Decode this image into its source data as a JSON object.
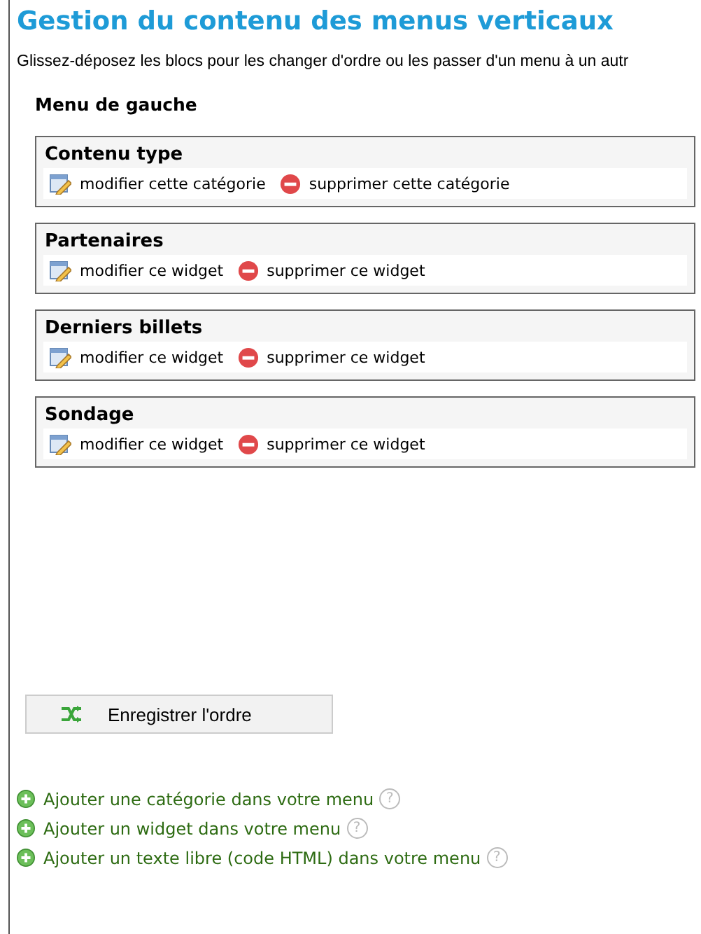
{
  "title": "Gestion du contenu des menus verticaux",
  "intro": "Glissez-déposez les blocs pour les changer d'ordre ou les passer d'un menu à un autr",
  "menu": {
    "heading": "Menu de gauche",
    "blocks": [
      {
        "name": "Contenu type",
        "edit": "modifier cette catégorie",
        "delete": "supprimer cette catégorie"
      },
      {
        "name": "Partenaires",
        "edit": "modifier ce widget",
        "delete": "supprimer ce widget"
      },
      {
        "name": "Derniers billets",
        "edit": "modifier ce widget",
        "delete": "supprimer ce widget"
      },
      {
        "name": "Sondage",
        "edit": "modifier ce widget",
        "delete": "supprimer ce widget"
      }
    ]
  },
  "save_button": "Enregistrer l'ordre",
  "add_links": [
    {
      "label": "Ajouter une catégorie dans votre menu",
      "help": "?"
    },
    {
      "label": "Ajouter un widget dans votre menu",
      "help": "?"
    },
    {
      "label": "Ajouter un texte libre (code HTML) dans votre menu",
      "help": "?"
    }
  ]
}
